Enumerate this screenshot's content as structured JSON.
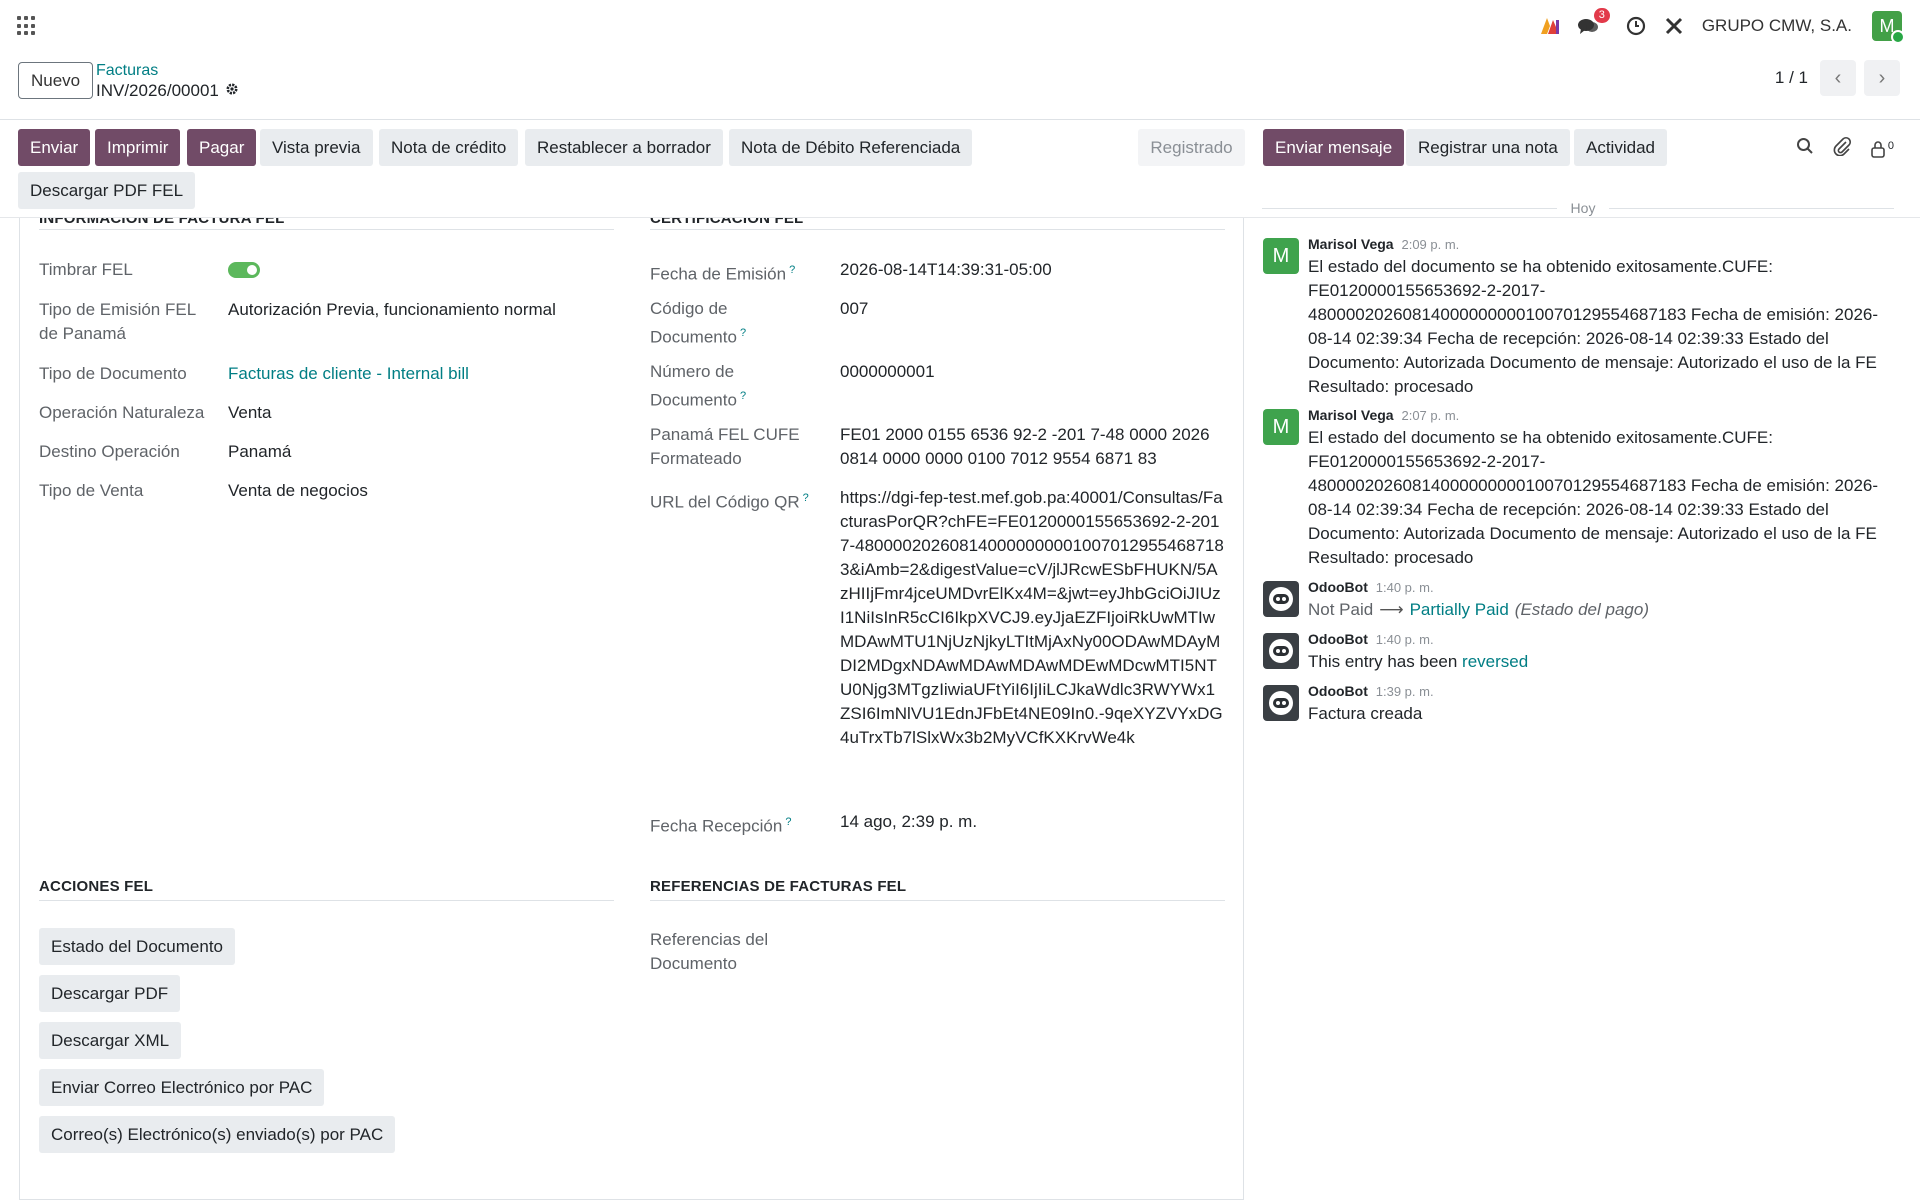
{
  "navbar": {
    "notification_count": "3",
    "company": "GRUPO CMW, S.A.",
    "user_initial": "M"
  },
  "control": {
    "new_label": "Nuevo",
    "breadcrumb_parent": "Facturas",
    "record_name": "INV/2026/00001",
    "pager_value": "1 / 1"
  },
  "actions": {
    "enviar": "Enviar",
    "imprimir": "Imprimir",
    "pagar": "Pagar",
    "vista_previa": "Vista previa",
    "nota_credito": "Nota de crédito",
    "restablecer": "Restablecer a borrador",
    "nota_debito": "Nota de Débito Referenciada",
    "descargar_pdf_fel": "Descargar PDF FEL",
    "status": "Registrado",
    "enviar_mensaje": "Enviar mensaje",
    "registrar_nota": "Registrar una nota",
    "actividad": "Actividad",
    "followers_count": "0"
  },
  "left_section": {
    "title": "INFORMACIÓN DE FACTURA FEL",
    "fields": {
      "timbrar_label": "Timbrar FEL",
      "timbrar_value": true,
      "tipo_emision_label": "Tipo de Emisión FEL de Panamá",
      "tipo_emision_value": "Autorización Previa, funcionamiento normal",
      "tipo_doc_label": "Tipo de Documento",
      "tipo_doc_value": "Facturas de cliente - Internal bill",
      "operacion_label": "Operación Naturaleza",
      "operacion_value": "Venta",
      "destino_label": "Destino Operación",
      "destino_value": "Panamá",
      "tipo_venta_label": "Tipo de Venta",
      "tipo_venta_value": "Venta de negocios"
    }
  },
  "right_section": {
    "title": "CERTIFICACIÓN FEL",
    "fields": {
      "fecha_emision_label": "Fecha de Emisión",
      "fecha_emision_value": "2026-08-14T14:39:31-05:00",
      "codigo_doc_label": "Código de Documento",
      "codigo_doc_value": "007",
      "numero_doc_label": "Número de Documento",
      "numero_doc_value": "0000000001",
      "cufe_label": "Panamá FEL CUFE Formateado",
      "cufe_value": "FE01 2000 0155 6536 92-2 -201 7-48 0000 2026 0814 0000 0000 0100 7012 9554 6871 83",
      "url_qr_label": "URL del Código QR",
      "url_qr_value": "https://dgi-fep-test.mef.gob.pa:40001/Consultas/FacturasPorQR?chFE=FE0120000155653692-2-2017-4800002026081400000000010070129554687183&iAmb=2&digestValue=cV/jlJRcwESbFHUKN/5AzHIIjFmr4jceUMDvrElKx4M=&jwt=eyJhbGciOiJIUzI1NiIsInR5cCI6IkpXVCJ9.eyJjaEZFIjoiRkUwMTIwMDAwMTU1NjUzNjkyLTItMjAxNy00ODAwMDAyMDI2MDgxNDAwMDAwMDAwMDEwMDcwMTI5NTU0Njg3MTgzIiwiaUFtYiI6IjIiLCJkaWdlc3RWYWx1ZSI6ImNlVU1EdnJFbEt4NE09In0.-9qeXYZVYxDG4uTrxTb7lSlxWx3b2MyVCfKXKrvWe4k",
      "fecha_recepcion_label": "Fecha Recepción",
      "fecha_recepcion_value": "14 ago, 2:39 p. m."
    }
  },
  "acciones": {
    "title": "ACCIONES FEL",
    "buttons": [
      "Estado del Documento",
      "Descargar PDF",
      "Descargar XML",
      "Enviar Correo Electrónico por PAC",
      "Correo(s) Electrónico(s) enviado(s) por PAC"
    ]
  },
  "referencias": {
    "title": "REFERENCIAS DE FACTURAS FEL",
    "label": "Referencias del Documento"
  },
  "chatter": {
    "today": "Hoy",
    "messages": [
      {
        "author": "Marisol Vega",
        "time": "2:09 p. m.",
        "body": "El estado del documento se ha obtenido exitosamente.CUFE: FE0120000155653692-2-2017-4800002026081400000000010070129554687183 Fecha de emisión: 2026-08-14 02:39:34 Fecha de recepción: 2026-08-14 02:39:33 Estado del Documento: Autorizada Documento de mensaje: Autorizado el uso de la FE Resultado: procesado"
      },
      {
        "author": "Marisol Vega",
        "time": "2:07 p. m.",
        "body": "El estado del documento se ha obtenido exitosamente.CUFE: FE0120000155653692-2-2017-4800002026081400000000010070129554687183 Fecha de emisión: 2026-08-14 02:39:34 Fecha de recepción: 2026-08-14 02:39:33 Estado del Documento: Autorizada Documento de mensaje: Autorizado el uso de la FE Resultado: procesado"
      },
      {
        "author": "OdooBot",
        "time": "1:40 p. m.",
        "old": "Not Paid",
        "new": "Partially Paid",
        "field": "(Estado del pago)"
      },
      {
        "author": "OdooBot",
        "time": "1:40 p. m.",
        "body_prefix": "This entry has been ",
        "link": "reversed"
      },
      {
        "author": "OdooBot",
        "time": "1:39 p. m.",
        "body": "Factura creada"
      }
    ]
  },
  "colors": {
    "primary": "#714b67",
    "link": "#017e84",
    "toggle_on": "#5cb85c"
  }
}
